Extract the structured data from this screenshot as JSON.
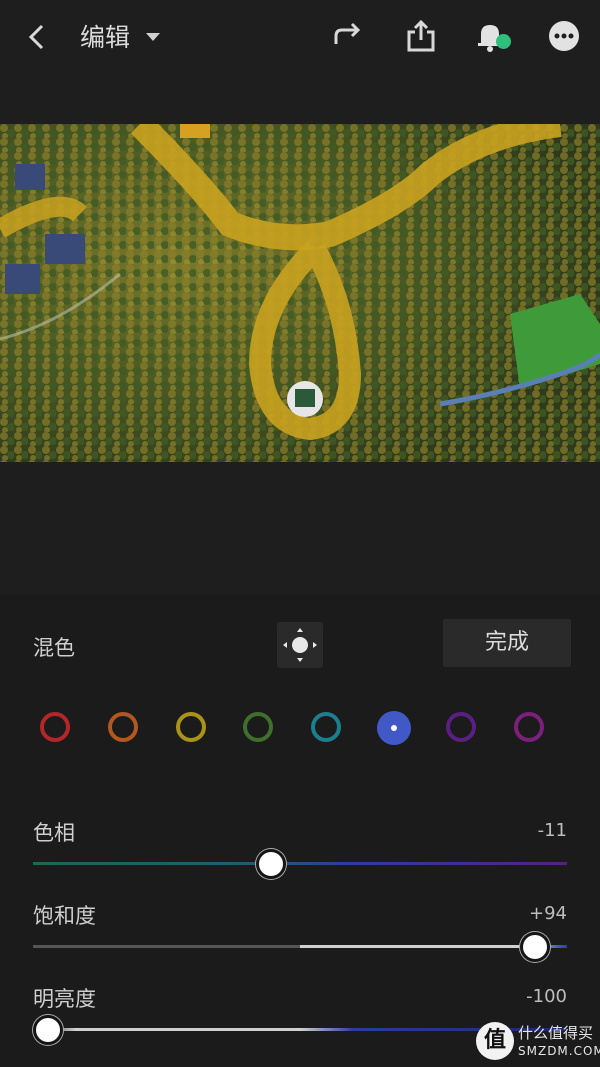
{
  "header": {
    "title": "编辑",
    "icons": [
      "back-icon",
      "redo-icon",
      "share-icon",
      "notification-bell-icon",
      "more-icon"
    ]
  },
  "mix": {
    "label": "混色",
    "done_label": "完成",
    "swatches": [
      {
        "name": "red",
        "color": "#b3262a"
      },
      {
        "name": "orange",
        "color": "#b4571e"
      },
      {
        "name": "yellow",
        "color": "#a99419"
      },
      {
        "name": "green",
        "color": "#3f6f2b"
      },
      {
        "name": "aqua",
        "color": "#1c7f8e"
      },
      {
        "name": "blue",
        "color": "#4159c6",
        "selected": true
      },
      {
        "name": "purple",
        "color": "#5a1f83"
      },
      {
        "name": "magenta",
        "color": "#7d1f7c"
      }
    ]
  },
  "sliders": {
    "hue": {
      "label": "色相",
      "value": "-11",
      "level": 0.45
    },
    "saturation": {
      "label": "饱和度",
      "value": "+94",
      "level": 0.94
    },
    "luminance": {
      "label": "明亮度",
      "value": "-100",
      "level": 0.0
    }
  },
  "watermark": {
    "logo": "值",
    "text1": "什么值得买",
    "text2": "SMZDM.COM"
  }
}
